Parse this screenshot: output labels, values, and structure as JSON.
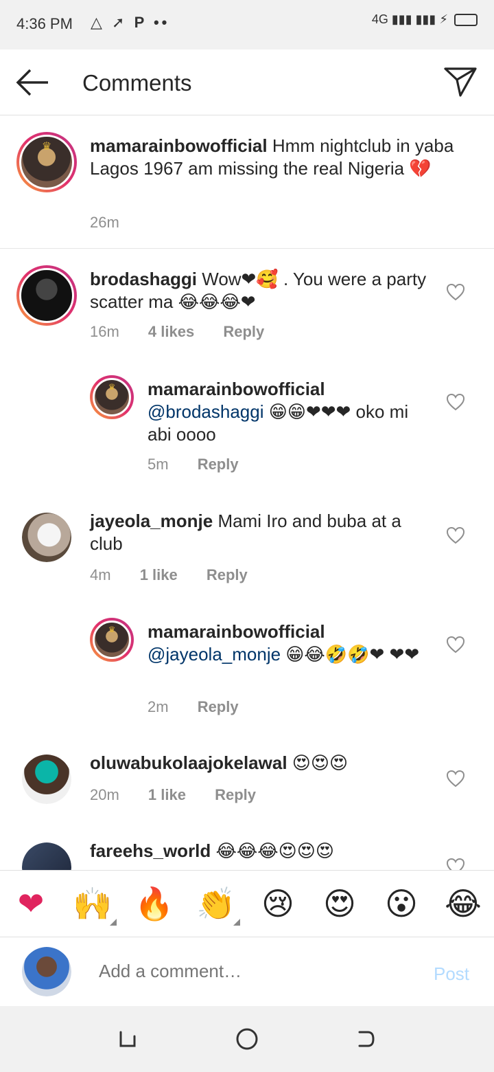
{
  "status_bar": {
    "time": "4:36 PM",
    "notifications": "△ ➚ P ••",
    "network": "4G",
    "signal": "▮▮▮ ▮▮▮ ⚡"
  },
  "header": {
    "title": "Comments"
  },
  "caption": {
    "username": "mamarainbowofficial",
    "text": "Hmm nightclub in yaba Lagos 1967 am missing the real Nigeria 💔",
    "time": "26m"
  },
  "comments": [
    {
      "username": "brodashaggi",
      "text": "Wow❤🥰 . You were a party scatter ma 😂😂😂❤",
      "time": "16m",
      "likes": "4 likes",
      "reply": "Reply"
    },
    {
      "username": "mamarainbowofficial",
      "mention": "@brodashaggi",
      "text": "😁😁❤❤❤ oko mi abi oooo",
      "time": "5m",
      "reply": "Reply"
    },
    {
      "username": "jayeola_monje",
      "text": "Mami Iro and buba at a club",
      "time": "4m",
      "likes": "1 like",
      "reply": "Reply"
    },
    {
      "username": "mamarainbowofficial",
      "mention": "@jayeola_monje",
      "text": "😁😂🤣🤣❤ ❤❤",
      "time": "2m",
      "reply": "Reply"
    },
    {
      "username": "oluwabukolaajokelawal",
      "text": "😍😍😍",
      "time": "20m",
      "likes": "1 like",
      "reply": "Reply"
    },
    {
      "username": "fareehs_world",
      "text": "😂😂😂😍😍😍"
    }
  ],
  "emoji_bar": [
    "❤",
    "🙌",
    "🔥",
    "👏",
    "😢",
    "😍",
    "😮",
    "😂"
  ],
  "input": {
    "placeholder": "Add a comment…",
    "post_label": "Post"
  }
}
